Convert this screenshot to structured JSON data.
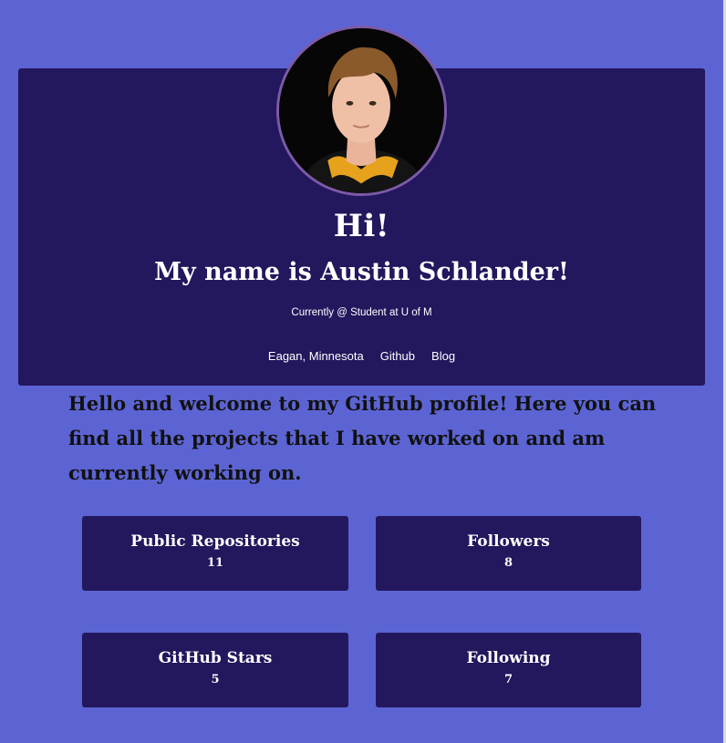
{
  "header": {
    "greeting": "Hi!",
    "name_line": "My name is Austin Schlander!",
    "status": "Currently @ Student at U of M",
    "links": [
      "Eagan, Minnesota",
      "Github",
      "Blog"
    ]
  },
  "welcome": "Hello and welcome to my GitHub profile! Here you can find all the projects that I have worked on and am currently working on.",
  "stats": [
    {
      "label": "Public Repositories",
      "value": "11"
    },
    {
      "label": "Followers",
      "value": "8"
    },
    {
      "label": "GitHub Stars",
      "value": "5"
    },
    {
      "label": "Following",
      "value": "7"
    }
  ],
  "colors": {
    "background": "#5c64d4",
    "card": "#23175d",
    "avatar_border": "#7c5aa8",
    "text_light": "#ffffff",
    "text_dark": "#111111"
  }
}
